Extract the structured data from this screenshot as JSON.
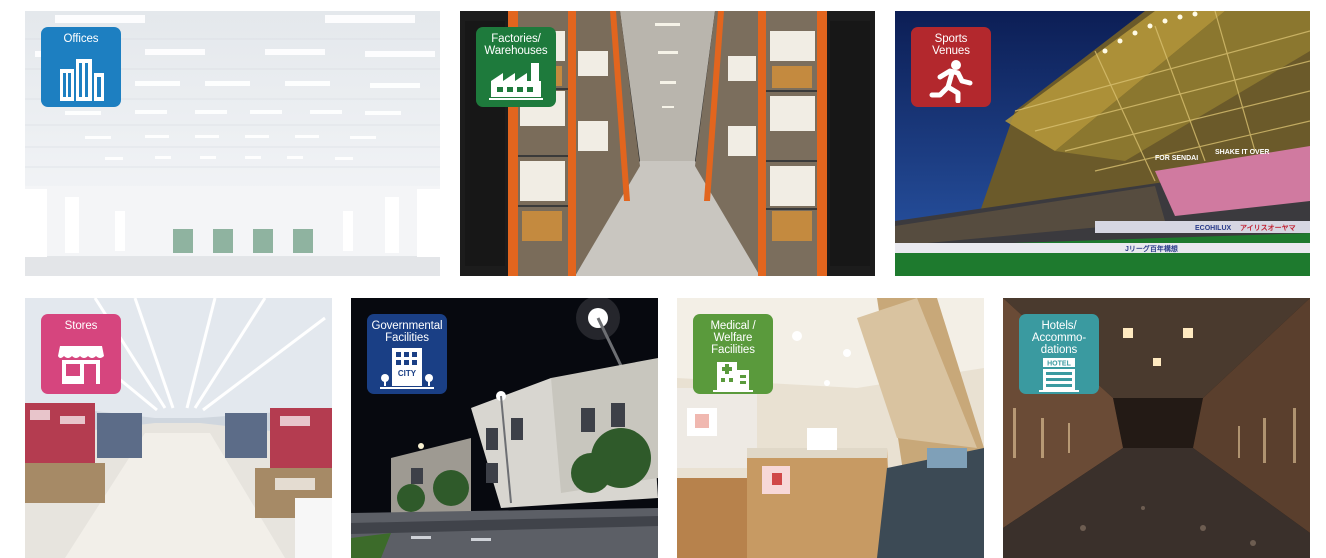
{
  "categories": [
    {
      "id": "offices",
      "label": "Offices",
      "icon": "office-buildings-icon",
      "color": "#1d7fc1"
    },
    {
      "id": "factories",
      "label": "Factories/\nWarehouses",
      "icon": "factory-icon",
      "color": "#1e7a3c"
    },
    {
      "id": "sports",
      "label": "Sports\nVenues",
      "icon": "running-person-icon",
      "color": "#b3282d"
    },
    {
      "id": "stores",
      "label": "Stores",
      "icon": "storefront-icon",
      "color": "#d6457e"
    },
    {
      "id": "government",
      "label": "Governmental\nFacilities",
      "icon": "city-hall-icon",
      "color": "#1a3f85",
      "icon_text": "CITY"
    },
    {
      "id": "medical",
      "label": "Medical /\nWelfare\nFacilities",
      "icon": "hospital-icon",
      "color": "#5a9a3c"
    },
    {
      "id": "hotels",
      "label": "Hotels/\nAccommo-\ndations",
      "icon": "hotel-building-icon",
      "color": "#3a9aa0",
      "icon_text": "HOTEL"
    }
  ],
  "stadium_signs": [
    "FOR SENDAI",
    "SHAKE IT OVER",
    "ECOHILUX",
    "アイリスオーヤマ",
    "Jリーグ百年構想"
  ]
}
